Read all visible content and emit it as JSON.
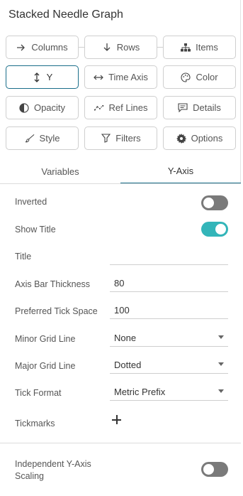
{
  "title": "Stacked Needle Graph",
  "buttons": {
    "columns": "Columns",
    "rows": "Rows",
    "items": "Items",
    "y": "Y",
    "time_axis": "Time Axis",
    "color": "Color",
    "opacity": "Opacity",
    "ref_lines": "Ref Lines",
    "details": "Details",
    "style": "Style",
    "filters": "Filters",
    "options": "Options"
  },
  "tabs": {
    "variables": "Variables",
    "y_axis": "Y-Axis",
    "selected": "Y-Axis"
  },
  "settings": {
    "inverted": {
      "label": "Inverted",
      "value": false
    },
    "show_title": {
      "label": "Show Title",
      "value": true
    },
    "title": {
      "label": "Title",
      "value": ""
    },
    "axis_bar_thickness": {
      "label": "Axis Bar Thickness",
      "value": "80"
    },
    "preferred_tick_space": {
      "label": "Preferred Tick Space",
      "value": "100"
    },
    "minor_grid_line": {
      "label": "Minor Grid Line",
      "value": "None"
    },
    "major_grid_line": {
      "label": "Major Grid Line",
      "value": "Dotted"
    },
    "tick_format": {
      "label": "Tick Format",
      "value": "Metric Prefix"
    },
    "tickmarks": {
      "label": "Tickmarks"
    },
    "independent_scaling": {
      "label_line1": "Independent Y-Axis",
      "label_line2": "Scaling",
      "value": false
    }
  },
  "colors": {
    "accent": "#1a6e8a",
    "toggle_on": "#33b5b9",
    "toggle_off": "#7a7a7a"
  }
}
